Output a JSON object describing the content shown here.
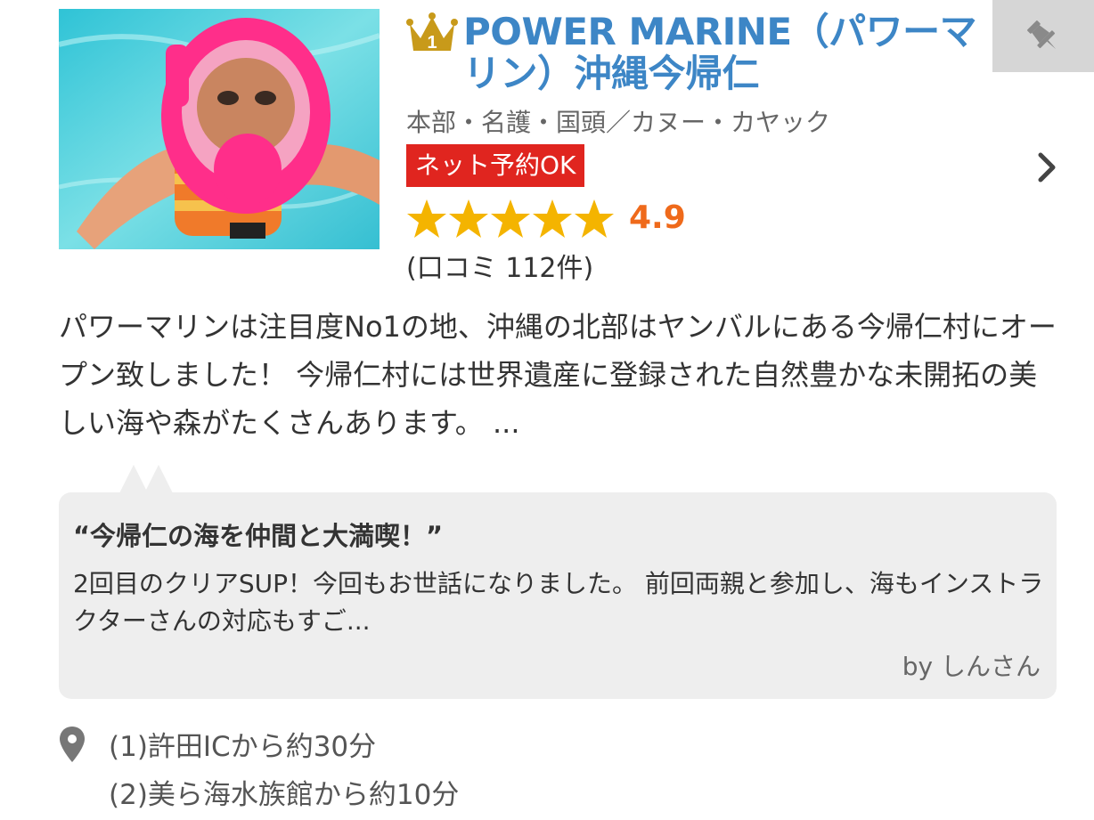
{
  "listing": {
    "rank": "1",
    "title": "POWER MARINE（パワーマリン）沖縄今帰仁",
    "category": "本部・名護・国頭／カヌー・カヤック",
    "badge": "ネット予約OK",
    "rating": "4.9",
    "stars": 5,
    "review_count": "(口コミ 112件)",
    "description": "パワーマリンは注目度No1の地、沖縄の北部はヤンバルにある今帰仁村にオープン致しました！ 今帰仁村には世界遺産に登録された自然豊かな未開拓の美しい海や森がたくさんあります。 ..."
  },
  "review": {
    "title": "“今帰仁の海を仲間と大満喫！”",
    "body": "2回目のクリアSUP！今回もお世話になりました。 前回両親と参加し、海もインストラクターさんの対応もすご...",
    "by": "by しんさん"
  },
  "access": {
    "line1": "(1)許田ICから約30分",
    "line2": "(2)美ら海水族館から約10分"
  },
  "icons": {
    "crown": "crown-icon",
    "pin_button": "pushpin-icon",
    "chevron": "chevron-right-icon",
    "location": "map-pin-icon"
  },
  "colors": {
    "title": "#3d86c6",
    "badge": "#e0251f",
    "rating": "#ef6a1b",
    "star": "#f4b400"
  }
}
